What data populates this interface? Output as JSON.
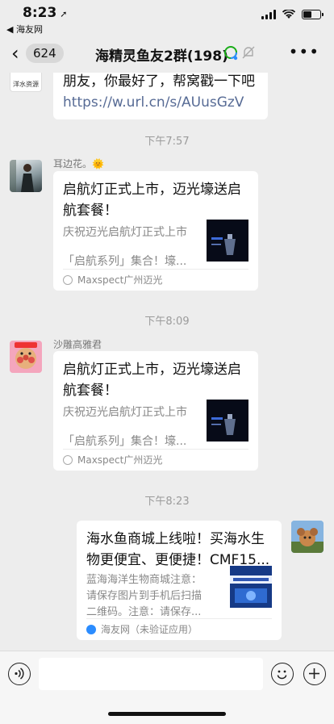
{
  "status": {
    "time": "8:23",
    "back_app": "◀ 海友网",
    "battery_level": 0.55
  },
  "nav": {
    "back_count": "624",
    "title": "海精灵鱼友2群(198)"
  },
  "messages": {
    "top_bubble": {
      "avatar_text": "洋水资源",
      "text": "朋友，你最好了，帮窝戳一下吧",
      "link": "https://w.url.cn/s/AUusGzV"
    },
    "t1": "下午7:57",
    "m1": {
      "sender": "耳边花。🌞",
      "title": "启航灯正式上市，迈光壕送启航套餐！",
      "desc1": "庆祝迈光启航灯正式上市",
      "desc2": "「启航系列」集合！壕...",
      "source": "Maxspect广州迈光"
    },
    "t2": "下午8:09",
    "m2": {
      "sender": "沙雕高雅君",
      "title": "启航灯正式上市，迈光壕送启航套餐！",
      "desc1": "庆祝迈光启航灯正式上市",
      "desc2": "「启航系列」集合！壕...",
      "source": "Maxspect广州迈光"
    },
    "t3": "下午8:23",
    "m3": {
      "title": "海水鱼商城上线啦！买海水生物更便宜、更便捷！CMF15...",
      "desc1": "蓝海海洋生物商城注意：",
      "desc2": "请保存图片到手机后扫描",
      "desc3": "二维码。注意：请保存...",
      "source": "海友网（未验证应用）"
    }
  },
  "colors": {
    "background": "#ededed",
    "link": "#576b95",
    "card": "#ffffff"
  }
}
